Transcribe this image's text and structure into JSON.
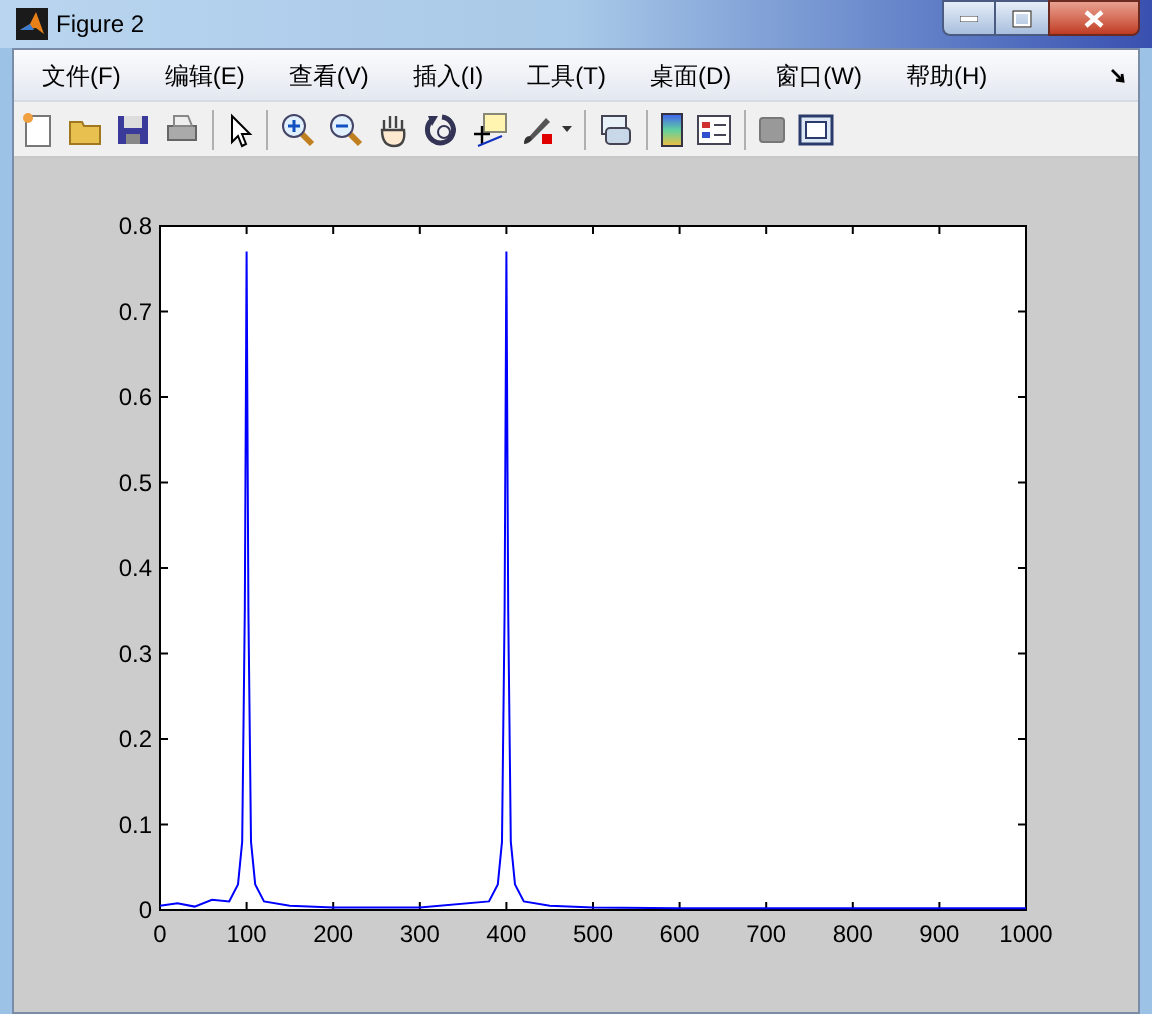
{
  "window": {
    "title": "Figure 2"
  },
  "menu": [
    "文件(F)",
    "编辑(E)",
    "查看(V)",
    "插入(I)",
    "工具(T)",
    "桌面(D)",
    "窗口(W)",
    "帮助(H)"
  ],
  "plot": {
    "chart_data": {
      "type": "line",
      "xlim": [
        0,
        1000
      ],
      "ylim": [
        0,
        0.8
      ],
      "xticks": [
        0,
        100,
        200,
        300,
        400,
        500,
        600,
        700,
        800,
        900,
        1000
      ],
      "yticks": [
        0,
        0.1,
        0.2,
        0.3,
        0.4,
        0.5,
        0.6,
        0.7,
        0.8
      ],
      "x": [
        0,
        20,
        40,
        60,
        80,
        90,
        95,
        98,
        100,
        102,
        105,
        110,
        120,
        150,
        200,
        300,
        380,
        390,
        395,
        398,
        400,
        402,
        405,
        410,
        420,
        450,
        500,
        600,
        700,
        800,
        900,
        1000
      ],
      "series": [
        {
          "color": "#0000ff",
          "values": [
            0.005,
            0.008,
            0.004,
            0.012,
            0.01,
            0.03,
            0.08,
            0.35,
            0.77,
            0.35,
            0.08,
            0.03,
            0.01,
            0.005,
            0.003,
            0.003,
            0.01,
            0.03,
            0.08,
            0.35,
            0.77,
            0.35,
            0.08,
            0.03,
            0.01,
            0.005,
            0.003,
            0.002,
            0.002,
            0.002,
            0.002,
            0.002
          ]
        }
      ]
    }
  }
}
